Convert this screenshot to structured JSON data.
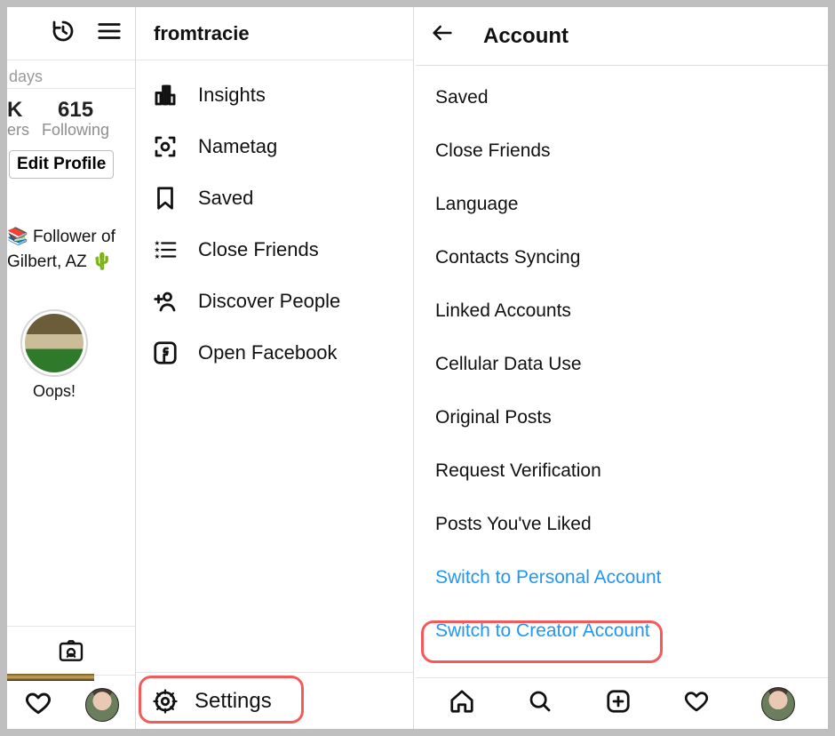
{
  "profile": {
    "days_fragment": "days",
    "stat1_num": "K",
    "stat1_lbl": "ers",
    "stat2_num": "615",
    "stat2_lbl": "Following",
    "edit_button": "Edit Profile",
    "bio_line1_emoji": "📚",
    "bio_line1": " Follower of",
    "bio_line2": "Gilbert, AZ ",
    "bio_line2_emoji": "🌵",
    "highlight_caption": "Oops!"
  },
  "panel": {
    "username": "fromtracie",
    "items": [
      {
        "label": "Insights"
      },
      {
        "label": "Nametag"
      },
      {
        "label": "Saved"
      },
      {
        "label": "Close Friends"
      },
      {
        "label": "Discover People"
      },
      {
        "label": "Open Facebook"
      }
    ],
    "settings_label": "Settings"
  },
  "account": {
    "title": "Account",
    "items": [
      {
        "label": "Saved",
        "blue": false
      },
      {
        "label": "Close Friends",
        "blue": false
      },
      {
        "label": "Language",
        "blue": false
      },
      {
        "label": "Contacts Syncing",
        "blue": false
      },
      {
        "label": "Linked Accounts",
        "blue": false
      },
      {
        "label": "Cellular Data Use",
        "blue": false
      },
      {
        "label": "Original Posts",
        "blue": false
      },
      {
        "label": "Request Verification",
        "blue": false
      },
      {
        "label": "Posts You've Liked",
        "blue": false
      },
      {
        "label": "Switch to Personal Account",
        "blue": true
      },
      {
        "label": "Switch to Creator Account",
        "blue": true
      }
    ]
  }
}
